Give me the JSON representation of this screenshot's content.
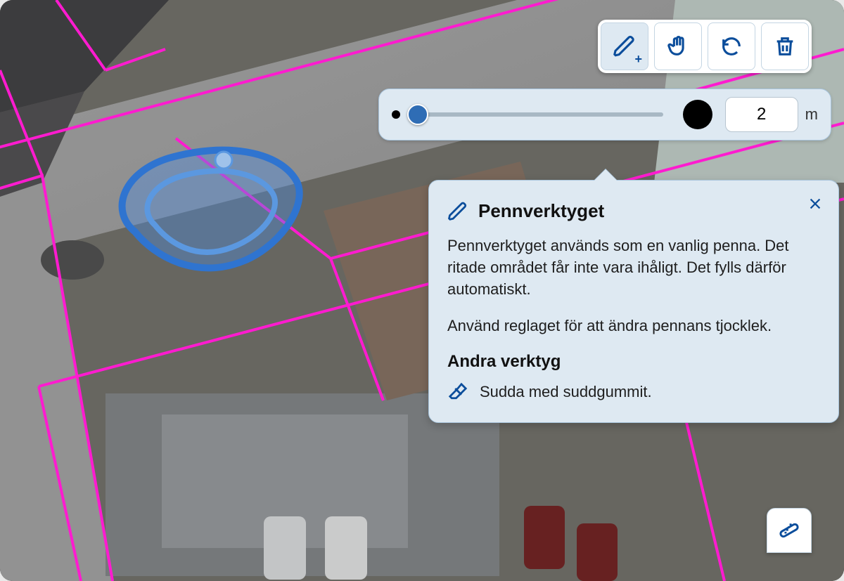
{
  "toolbar": {
    "pencil": "pencil",
    "pan": "pan",
    "undo": "undo",
    "delete": "delete",
    "active": "pencil"
  },
  "stroke_size": {
    "min": 1,
    "max": 20,
    "value": "2",
    "unit": "m",
    "slider_percent": 3
  },
  "popover": {
    "title": "Pennverktyget",
    "body1": "Pennverktyget används som en vanlig penna. Det ritade området får inte vara ihåligt. Det fylls därför automatiskt.",
    "body2": "Använd reglaget för att ändra pennans tjocklek.",
    "other_heading": "Andra verktyg",
    "other_tool_label": "Sudda med suddgummit."
  },
  "measure_button": "measure",
  "colors": {
    "parcel_line": "#ff1bd0",
    "draw_stroke": "#2f74d0",
    "draw_fill": "rgba(84,143,226,0.4)"
  }
}
